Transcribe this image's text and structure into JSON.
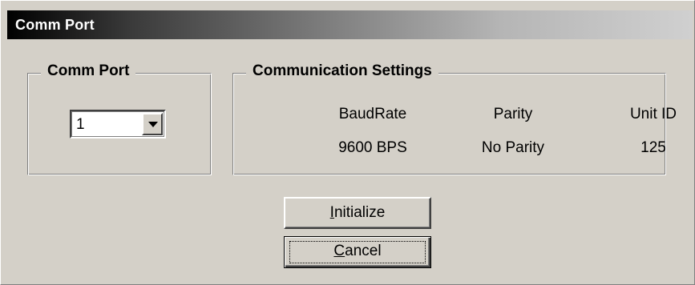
{
  "window": {
    "title": "Comm Port"
  },
  "comm_port_group": {
    "legend": "Comm Port",
    "combo": {
      "selected_value": "1",
      "dropdown_icon": "chevron-down-icon"
    }
  },
  "communication_settings": {
    "legend": "Communication Settings",
    "columns": [
      {
        "label": "BaudRate",
        "value": "9600 BPS"
      },
      {
        "label": "Parity",
        "value": "No Parity"
      },
      {
        "label": "Unit ID",
        "value": "125"
      }
    ]
  },
  "buttons": {
    "initialize": {
      "mnemonic": "I",
      "rest": "nitialize"
    },
    "cancel": {
      "mnemonic": "C",
      "rest": "ancel"
    }
  },
  "colors": {
    "face": "#d4d0c8",
    "titlebar_start": "#000000",
    "titlebar_end": "#d0d0d0",
    "title_text": "#ffffff"
  }
}
